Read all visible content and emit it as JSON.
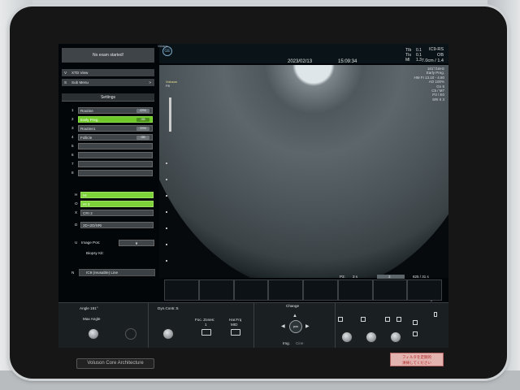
{
  "bezel": {
    "brand": "Voluson Core Architecture"
  },
  "sticker": {
    "line1": "フィルタを定期的",
    "line2": "清掃してください"
  },
  "left_panel": {
    "no_exam": "No exam started!",
    "rows": [
      {
        "key": "V",
        "label": "XTD View",
        "chev": ""
      },
      {
        "key": "S",
        "label": "Sub Menu",
        "chev": ">"
      }
    ],
    "settings_title": "Settings",
    "presets": [
      {
        "num": "1",
        "label": "Routine",
        "tag": "GYN",
        "active": false
      },
      {
        "num": "2",
        "label": "Early Preg.",
        "tag": "OB",
        "active": true
      },
      {
        "num": "3",
        "label": "Routine1",
        "tag": "GYN",
        "active": false
      },
      {
        "num": "4",
        "label": "Follicle",
        "tag": "OB",
        "active": false
      },
      {
        "num": "5",
        "label": "",
        "tag": "",
        "active": false
      },
      {
        "num": "6",
        "label": "",
        "tag": "",
        "active": false
      },
      {
        "num": "7",
        "label": "",
        "tag": "",
        "active": false
      },
      {
        "num": "8",
        "label": "",
        "tag": "",
        "active": false
      }
    ],
    "mode_rows": [
      {
        "key": "H",
        "label": "HI",
        "green": true
      },
      {
        "key": "O",
        "label": "HI 3",
        "green": true
      },
      {
        "key": "X",
        "label": "CRI 2",
        "green": false
      },
      {
        "key": "D",
        "label": "2D+2D/SRI",
        "green": false
      }
    ],
    "image_pos_key": "U",
    "image_pos_label": "Image Pos:",
    "image_pos_value": "¥",
    "biopsy_label": "Biopsy Kit:",
    "probe_key": "N",
    "probe_label": "IC9 (reusable) Line"
  },
  "header": {
    "logo_text": "Voluson",
    "date": "2023/02/13",
    "time": "15:09:34",
    "tib_label": "TIb",
    "tib_value": "0.1",
    "tis_label": "TIs",
    "tis_value": "0.1",
    "mi_label": "MI",
    "mi_value": "1.3",
    "probe": "IC9-RS",
    "app": "OB",
    "depth": "7.0cm / 1.4"
  },
  "image_params": [
    "181°/16Hz",
    "Early Preg.",
    "HM FI 13.10 - 4.80",
    "AO 100%",
    "Gn 5",
    "C5 / M7",
    "P3 / E0",
    "SRI II 3"
  ],
  "image_labels": {
    "l1": "Voluson",
    "l2": "P8"
  },
  "status_strip": {
    "p3": "P3:",
    "s": "3 s",
    "fr": "3",
    "fr2": "56",
    "frames": "825 / 31 s",
    "page": "Page 1/1"
  },
  "touch_panel": {
    "angle": "Angle 181°",
    "max_angle": "Max Angle",
    "dyn_contr": "Dyn.Contr.:5",
    "foc_zones": "Foc. Zones:",
    "foc_zones_value": "1",
    "har_frq": "Har.Frq",
    "har_frq_value": "MID",
    "change": "Change",
    "pos": "pos",
    "img": "Img.",
    "cine": "Cine"
  }
}
